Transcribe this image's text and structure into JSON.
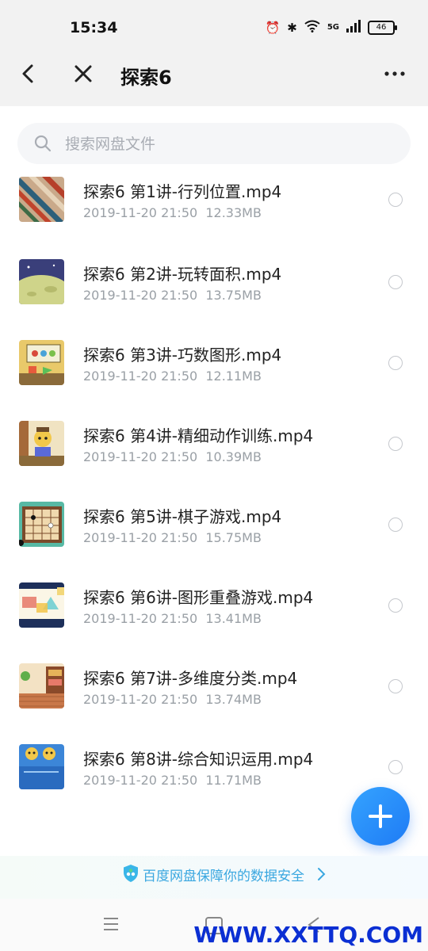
{
  "status": {
    "time": "15:34",
    "network": "5G",
    "battery": "46"
  },
  "header": {
    "title": "探索6"
  },
  "search": {
    "placeholder": "搜索网盘文件"
  },
  "files": [
    {
      "name": "探索6 第1讲-行列位置.mp4",
      "date": "2019-11-20  21:50",
      "size": "12.33MB"
    },
    {
      "name": "探索6 第2讲-玩转面积.mp4",
      "date": "2019-11-20  21:50",
      "size": "13.75MB"
    },
    {
      "name": "探索6 第3讲-巧数图形.mp4",
      "date": "2019-11-20  21:50",
      "size": "12.11MB"
    },
    {
      "name": "探索6 第4讲-精细动作训练.mp4",
      "date": "2019-11-20  21:50",
      "size": "10.39MB"
    },
    {
      "name": "探索6 第5讲-棋子游戏.mp4",
      "date": "2019-11-20  21:50",
      "size": "15.75MB"
    },
    {
      "name": "探索6 第6讲-图形重叠游戏.mp4",
      "date": "2019-11-20  21:50",
      "size": "13.41MB"
    },
    {
      "name": "探索6 第7讲-多维度分类.mp4",
      "date": "2019-11-20  21:50",
      "size": "13.74MB"
    },
    {
      "name": "探索6 第8讲-综合知识运用.mp4",
      "date": "2019-11-20  21:50",
      "size": "11.71MB"
    }
  ],
  "footer": {
    "safety_text": "百度网盘保障你的数据安全"
  },
  "watermark": "WWW.XXTTQ.COM",
  "colors": {
    "accent": "#2b8ff8",
    "fab": "#1e7bf5",
    "safety_text": "#3aa7e0"
  }
}
